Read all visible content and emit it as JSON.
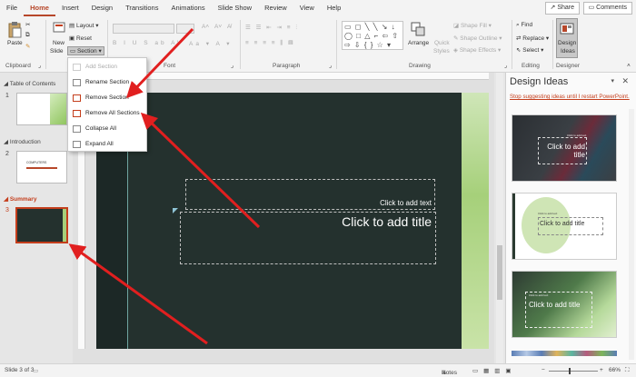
{
  "tabs": [
    "File",
    "Home",
    "Insert",
    "Design",
    "Transitions",
    "Animations",
    "Slide Show",
    "Review",
    "View",
    "Help"
  ],
  "active_tab": "Home",
  "share_label": "Share",
  "comments_label": "Comments",
  "ribbon": {
    "paste_label": "Paste",
    "new_slide_label": "New",
    "new_slide_label2": "Slide",
    "layout_label": "Layout",
    "reset_label": "Reset",
    "section_label": "Section",
    "shape_fill_label": "Shape Fill",
    "shape_outline_label": "Shape Outline",
    "shape_effects_label": "Shape Effects",
    "arrange_label": "Arrange",
    "quick_styles_label": "Quick",
    "quick_styles_label2": "Styles",
    "find_label": "Find",
    "replace_label": "Replace",
    "select_label": "Select",
    "design_ideas_label": "Design",
    "design_ideas_label2": "Ideas",
    "groups": {
      "clipboard": "Clipboard",
      "font": "Font",
      "paragraph": "Paragraph",
      "drawing": "Drawing",
      "editing": "Editing",
      "designer": "Designer"
    }
  },
  "thumbnails": {
    "section1": "Table of Contents",
    "section2": "Introduction",
    "section3": "Summary",
    "slide_nums": [
      "1",
      "2",
      "3"
    ],
    "slide2_text": "COMPUTERS"
  },
  "menu": {
    "items": [
      "Add Section",
      "Rename Section",
      "Remove Section",
      "Remove All Sections",
      "Collapse All",
      "Expand All"
    ],
    "disabled_index": 0
  },
  "slide": {
    "subtitle_placeholder": "Click to add text",
    "title_placeholder": "Click to add title"
  },
  "design_pane": {
    "title": "Design Ideas",
    "stop_link": "Stop suggesting ideas until I restart PowerPoint.",
    "idea1_title": "Click to add title",
    "idea2_title": "Click to add title",
    "idea3_title": "Click to add title",
    "idea_subtitle": "Click to add text"
  },
  "status": {
    "slide_of": "Slide 3 of 3",
    "notes": "Notes",
    "zoom": "66%"
  },
  "colors": {
    "accent": "#b7472a",
    "link": "#c43e1c",
    "arrow": "#e11f1f",
    "slide_bg": "#24312e"
  }
}
